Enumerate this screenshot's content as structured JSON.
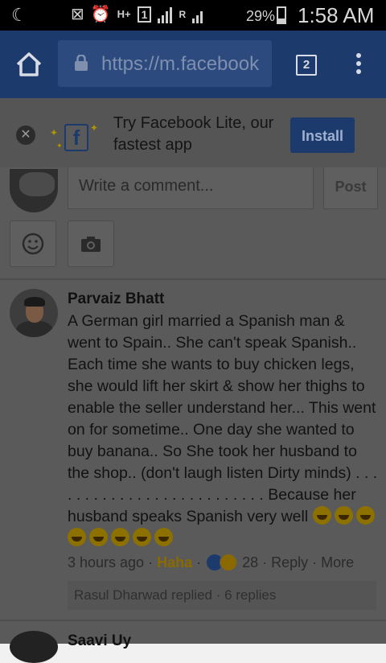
{
  "status_bar": {
    "network_labels": [
      "H+",
      "1",
      "R"
    ],
    "battery_percent": "29%",
    "time": "1:58 AM"
  },
  "browser": {
    "url": "https://m.facebook",
    "tab_count": "2"
  },
  "banner": {
    "text": "Try Facebook Lite, our fastest app",
    "logo_letter": "f",
    "install_label": "Install"
  },
  "composer": {
    "placeholder": "Write a comment...",
    "post_label": "Post"
  },
  "comment": {
    "author": "Parvaiz Bhatt",
    "text": "A German girl married a Spanish man & went to Spain.. She can't speak Spanish.. Each time she wants to buy chicken legs, she would lift her skirt & show her thighs to enable the seller understand her... This went on for sometime.. One day she wanted to buy banana.. So She took her husband to the shop.. (don't laugh listen Dirty minds) . . . . . . . . . . . . . . . . . . . . . . . . . . Because her husband speaks Spanish very well",
    "emoji_count": 8,
    "time": "3 hours ago",
    "reaction_label": "Haha",
    "reaction_count": "28",
    "reply_label": "Reply",
    "more_label": "More",
    "replies_summary": "Rasul Dharwad replied · 6 replies"
  },
  "next_comment": {
    "author": "Saavi Uy"
  },
  "colors": {
    "fb_blue": "#1d3a6d",
    "haha_gold": "#8a6a00",
    "overlay_gray": "#5a5a5a"
  }
}
